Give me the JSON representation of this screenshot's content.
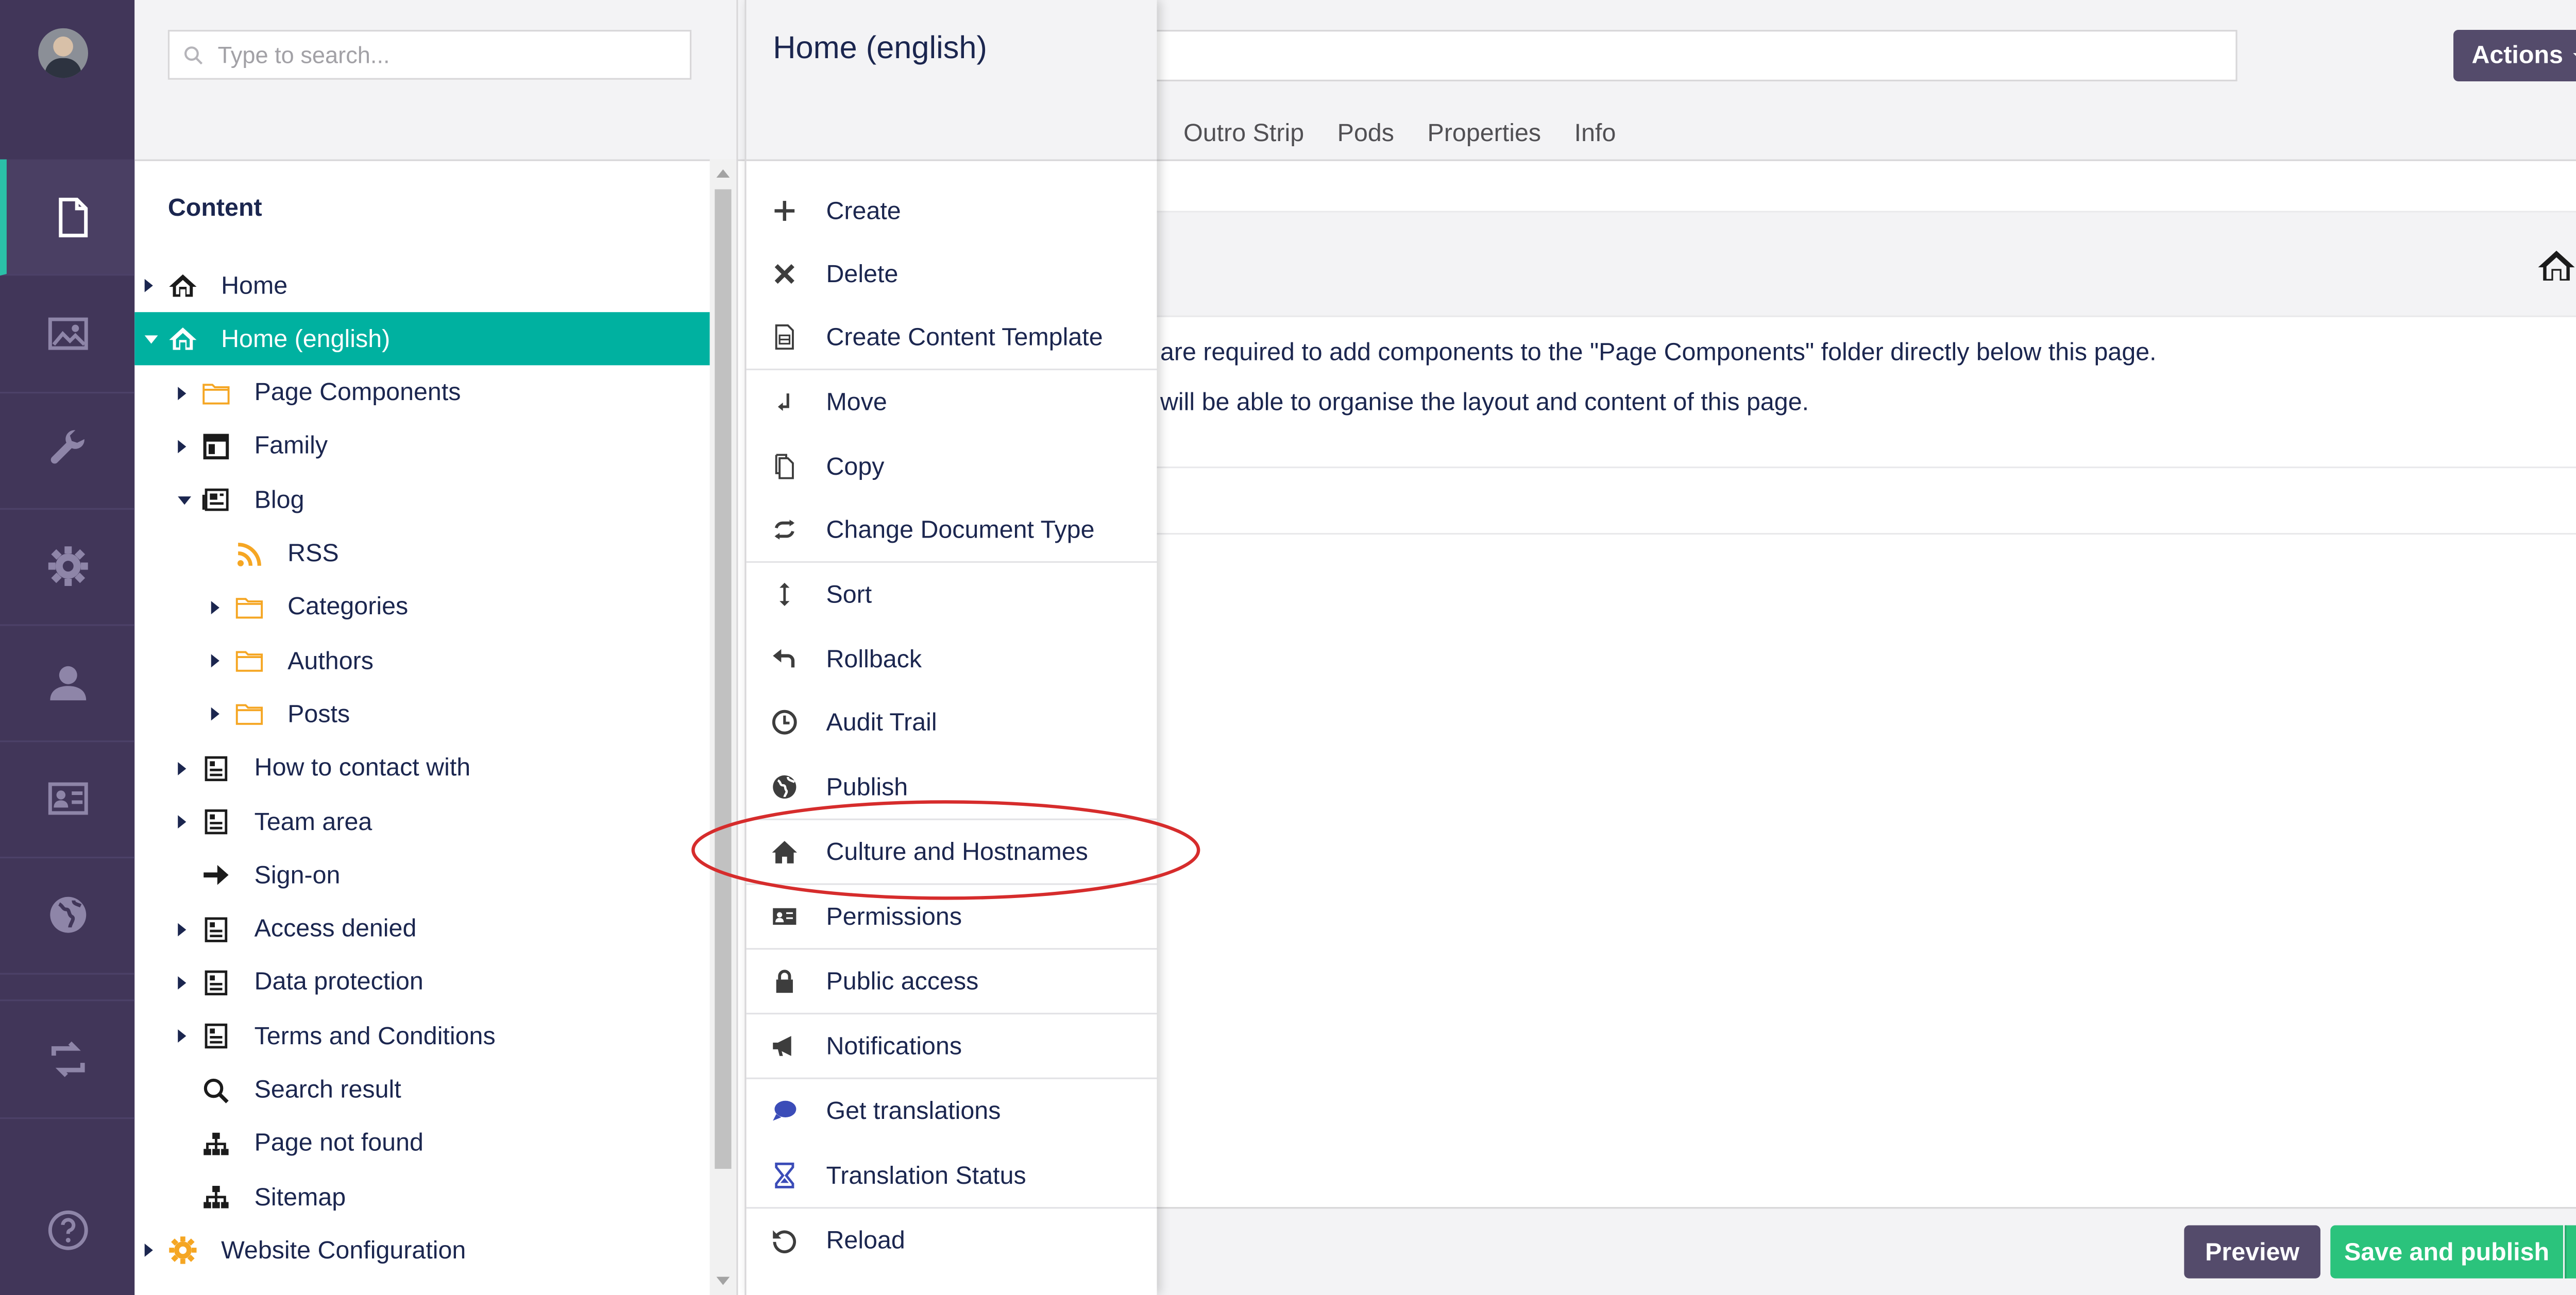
{
  "colors": {
    "sections_bg": "#413659",
    "selected_tree_bg": "#00b1a0",
    "folder_icon": "#f5a623",
    "actions_button_bg": "#544b6b",
    "save_button_bg": "#2bc37c",
    "annotation_ellipse": "#d62c2c",
    "translations_icon": "#3b4cb8"
  },
  "sections": {
    "items": [
      {
        "name": "content",
        "icon": "document-icon"
      },
      {
        "name": "media",
        "icon": "image-icon"
      },
      {
        "name": "settings",
        "icon": "wrench-icon"
      },
      {
        "name": "developer",
        "icon": "gear-icon"
      },
      {
        "name": "users",
        "icon": "user-icon"
      },
      {
        "name": "members",
        "icon": "id-card-icon"
      },
      {
        "name": "translation",
        "icon": "globe-icon"
      },
      {
        "name": "forms",
        "icon": "transfer-icon"
      },
      {
        "name": "help",
        "icon": "help-icon"
      }
    ]
  },
  "tree": {
    "search_placeholder": "Type to search...",
    "title": "Content",
    "nodes": [
      {
        "label": "Home",
        "icon": "home-icon",
        "expander": "right"
      },
      {
        "label": "Home (english)",
        "icon": "home-icon",
        "expander": "down",
        "selected": true
      },
      {
        "label": "Page Components",
        "icon": "folder-icon",
        "expander": "right"
      },
      {
        "label": "Family",
        "icon": "layout-icon",
        "expander": "right"
      },
      {
        "label": "Blog",
        "icon": "newspaper-icon",
        "expander": "down"
      },
      {
        "label": "RSS",
        "icon": "rss-icon",
        "expander": "none"
      },
      {
        "label": "Categories",
        "icon": "folder-icon",
        "expander": "right"
      },
      {
        "label": "Authors",
        "icon": "folder-icon",
        "expander": "right"
      },
      {
        "label": "Posts",
        "icon": "folder-icon",
        "expander": "right"
      },
      {
        "label": "How to contact with",
        "icon": "document-list-icon",
        "expander": "right"
      },
      {
        "label": "Team area",
        "icon": "document-list-icon",
        "expander": "right"
      },
      {
        "label": "Sign-on",
        "icon": "arrow-right-icon",
        "expander": "none"
      },
      {
        "label": "Access denied",
        "icon": "document-list-icon",
        "expander": "right"
      },
      {
        "label": "Data protection",
        "icon": "document-list-icon",
        "expander": "right"
      },
      {
        "label": "Terms and Conditions",
        "icon": "document-list-icon",
        "expander": "right"
      },
      {
        "label": "Search result",
        "icon": "search-icon",
        "expander": "none"
      },
      {
        "label": "Page not found",
        "icon": "sitemap-icon",
        "expander": "none"
      },
      {
        "label": "Sitemap",
        "icon": "sitemap-icon",
        "expander": "none"
      },
      {
        "label": "Website Configuration",
        "icon": "gear-orange-icon",
        "expander": "right"
      }
    ]
  },
  "editor": {
    "actions_label": "Actions",
    "tabs": [
      "Outro Strip",
      "Pods",
      "Properties",
      "Info"
    ],
    "info_lines": [
      "are required to add components to the \"Page Components\" folder directly below this page.",
      "will be able to organise the layout and content of this page."
    ],
    "preview_label": "Preview",
    "save_publish_label": "Save and publish"
  },
  "menu": {
    "title": "Home (english)",
    "items": [
      {
        "label": "Create",
        "icon": "plus-icon"
      },
      {
        "label": "Delete",
        "icon": "x-icon"
      },
      {
        "label": "Create Content Template",
        "icon": "template-icon"
      },
      {
        "label": "Move",
        "icon": "move-icon"
      },
      {
        "label": "Copy",
        "icon": "copy-icon"
      },
      {
        "label": "Change Document Type",
        "icon": "exchange-icon"
      },
      {
        "label": "Sort",
        "icon": "sort-icon"
      },
      {
        "label": "Rollback",
        "icon": "undo-icon"
      },
      {
        "label": "Audit Trail",
        "icon": "clock-icon"
      },
      {
        "label": "Publish",
        "icon": "globe-icon"
      },
      {
        "label": "Culture and Hostnames",
        "icon": "home-icon"
      },
      {
        "label": "Permissions",
        "icon": "id-icon"
      },
      {
        "label": "Public access",
        "icon": "lock-icon"
      },
      {
        "label": "Notifications",
        "icon": "megaphone-icon"
      },
      {
        "label": "Get translations",
        "icon": "chat-bubble-icon"
      },
      {
        "label": "Translation Status",
        "icon": "hourglass-icon"
      },
      {
        "label": "Reload",
        "icon": "reload-icon"
      }
    ]
  }
}
